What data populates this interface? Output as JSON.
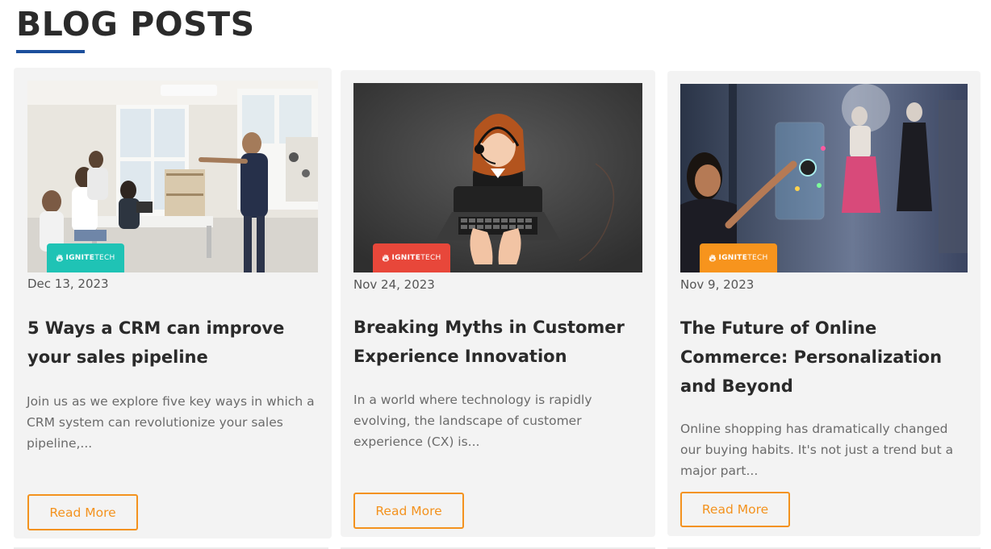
{
  "section": {
    "title": "BLOG POSTS",
    "accent": "#1c4f9c"
  },
  "button_color": "#f3921e",
  "brand": {
    "name_bold": "IGNITE",
    "name_light": "TECH"
  },
  "posts": [
    {
      "date": "Dec 13, 2023",
      "title": "5 Ways a CRM can improve your sales pipeline",
      "excerpt": "Join us as we explore five key ways in which a CRM system can revolutionize your sales pipeline,...",
      "read_more": "Read More",
      "image": "office-presentation-photo",
      "badge_color": "#1fc3b5"
    },
    {
      "date": "Nov 24, 2023",
      "title": "Breaking Myths in Customer Experience Innovation",
      "excerpt": "In a world where technology is rapidly evolving, the landscape of customer experience (CX) is...",
      "read_more": "Read More",
      "image": "support-agent-laptop-photo",
      "badge_color": "#e8473a"
    },
    {
      "date": "Nov 9, 2023",
      "title": "The Future of Online Commerce: Personalization and Beyond",
      "excerpt": "Online shopping has dramatically changed our buying habits. It's not just a trend but a major part...",
      "read_more": "Read More",
      "image": "shop-window-touchscreen-photo",
      "badge_color": "#f7941d"
    }
  ]
}
